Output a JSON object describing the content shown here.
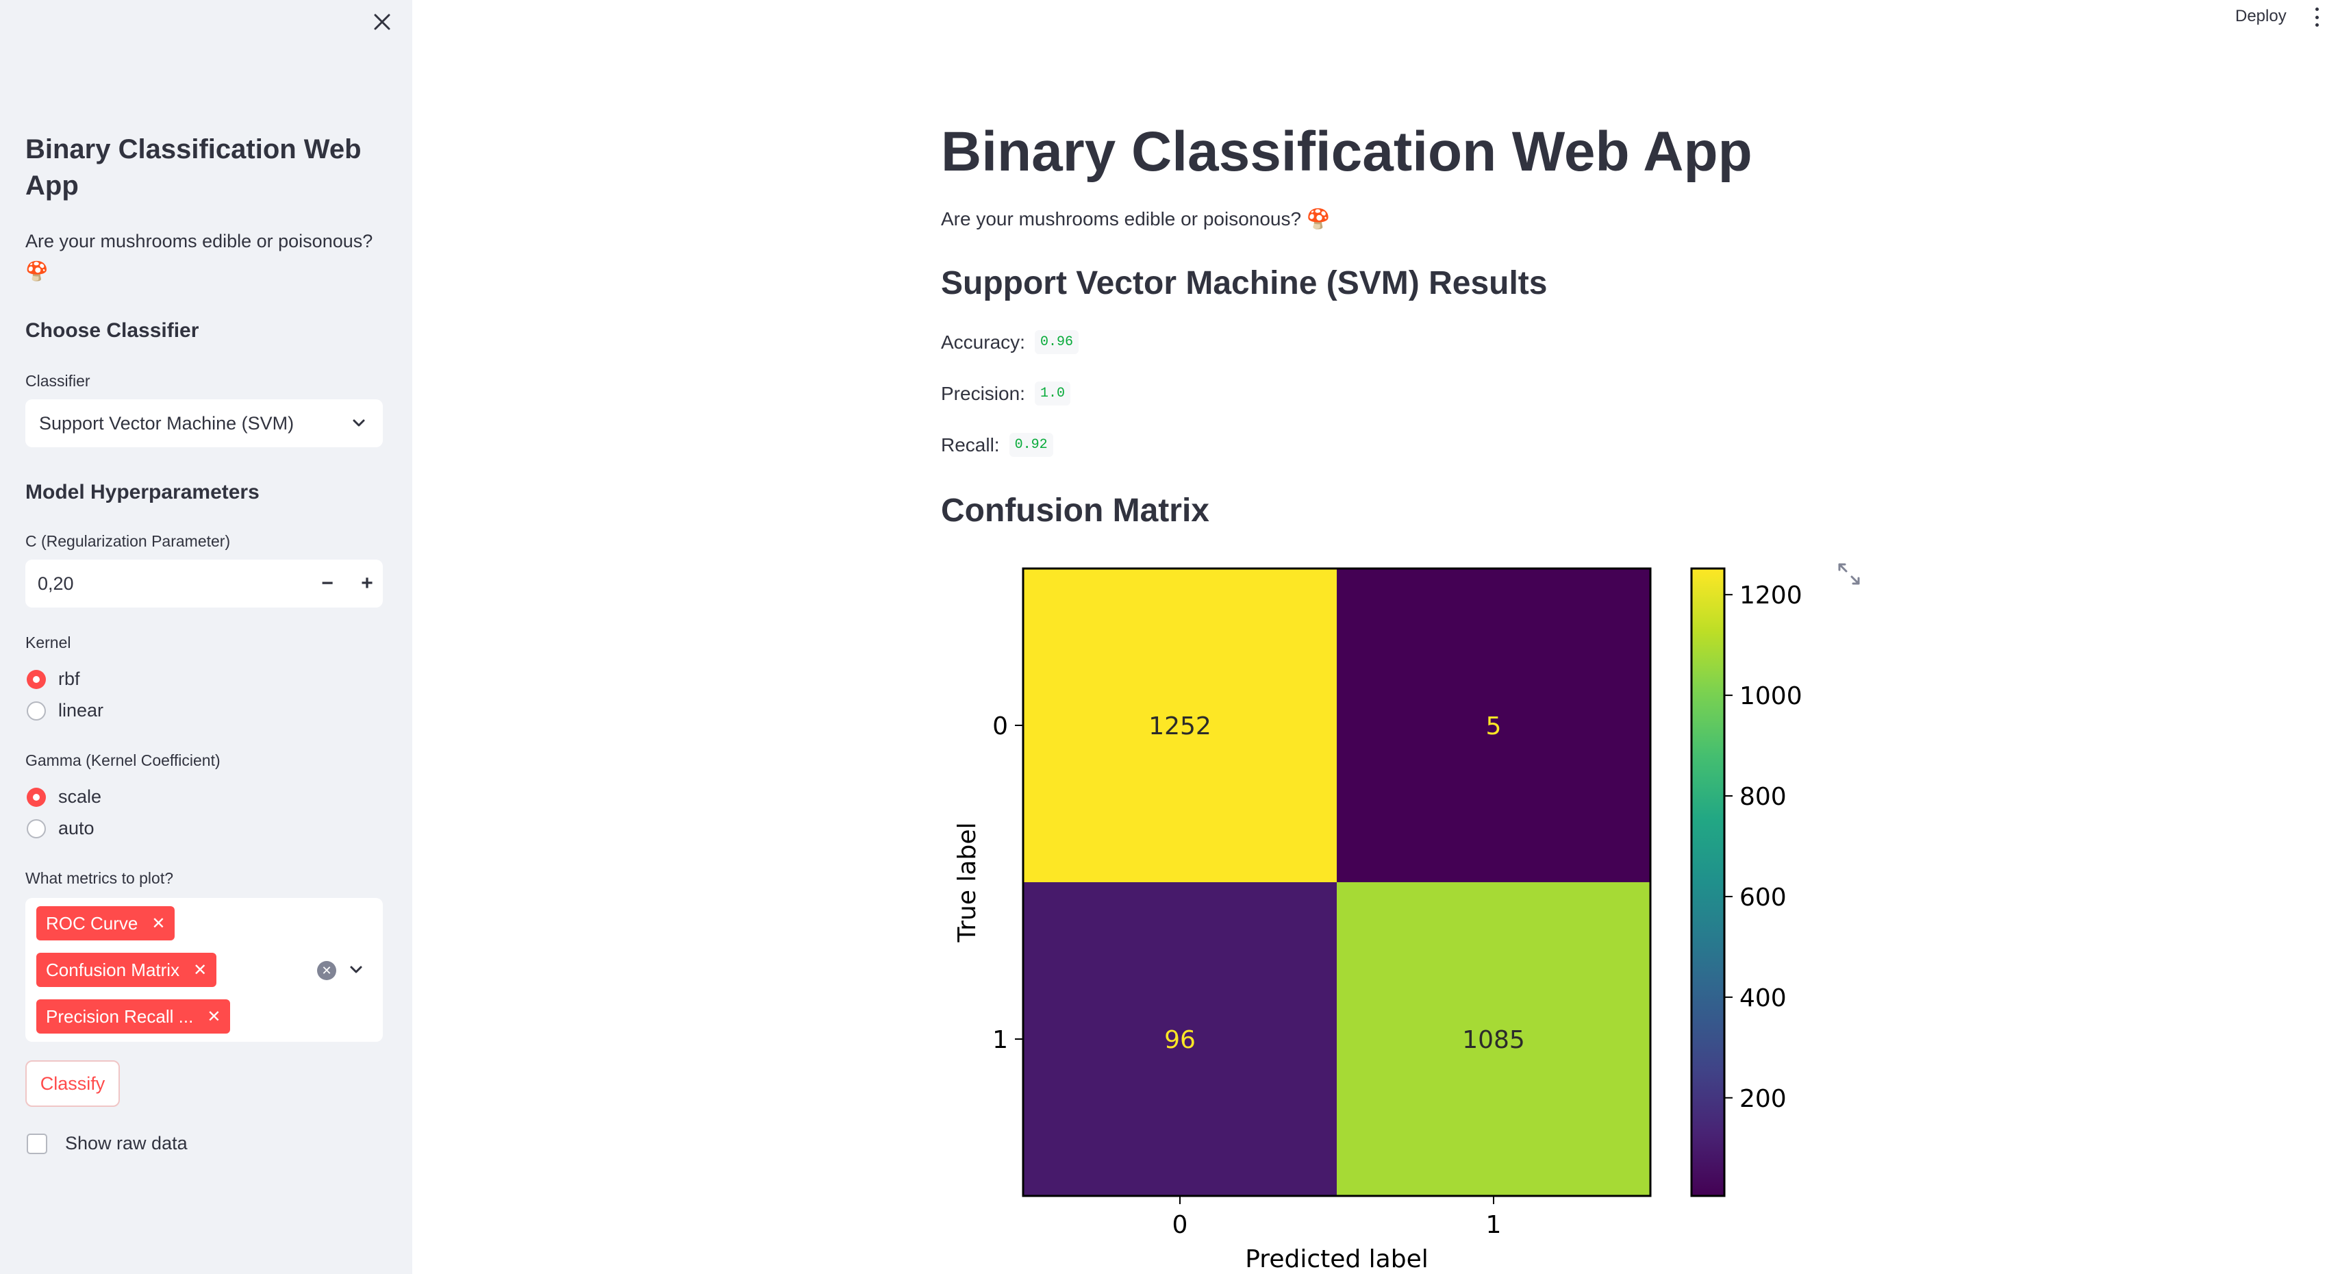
{
  "header": {
    "deploy_label": "Deploy"
  },
  "sidebar": {
    "title": "Binary Classification Web App",
    "subtitle": "Are your mushrooms edible or poisonous? 🍄",
    "choose_classifier_heading": "Choose Classifier",
    "classifier_label": "Classifier",
    "classifier_value": "Support Vector Machine (SVM)",
    "hyperparams_heading": "Model Hyperparameters",
    "c_label": "C (Regularization Parameter)",
    "c_value": "0,20",
    "kernel_label": "Kernel",
    "kernel_options": [
      "rbf",
      "linear"
    ],
    "kernel_selected": "rbf",
    "gamma_label": "Gamma (Kernel Coefficient)",
    "gamma_options": [
      "scale",
      "auto"
    ],
    "gamma_selected": "scale",
    "metrics_label": "What metrics to plot?",
    "metrics_selected": [
      "ROC Curve",
      "Confusion Matrix",
      "Precision Recall ..."
    ],
    "classify_label": "Classify",
    "raw_data_label": "Show raw data"
  },
  "main": {
    "title": "Binary Classification Web App",
    "subtitle": "Are your mushrooms edible or poisonous? 🍄",
    "results_heading": "Support Vector Machine (SVM) Results",
    "metrics": [
      {
        "label": "Accuracy:",
        "value": "0.96"
      },
      {
        "label": "Precision:",
        "value": "1.0"
      },
      {
        "label": "Recall:",
        "value": "0.92"
      }
    ],
    "cm_heading": "Confusion Matrix"
  },
  "chart_data": {
    "type": "heatmap",
    "title": "",
    "xlabel": "Predicted label",
    "ylabel": "True label",
    "x_categories": [
      "0",
      "1"
    ],
    "y_categories": [
      "0",
      "1"
    ],
    "values": [
      [
        1252,
        5
      ],
      [
        96,
        1085
      ]
    ],
    "colormap": "viridis",
    "colorbar_ticks": [
      200,
      400,
      600,
      800,
      1000,
      1200
    ],
    "colorbar_range": [
      5,
      1252
    ]
  }
}
